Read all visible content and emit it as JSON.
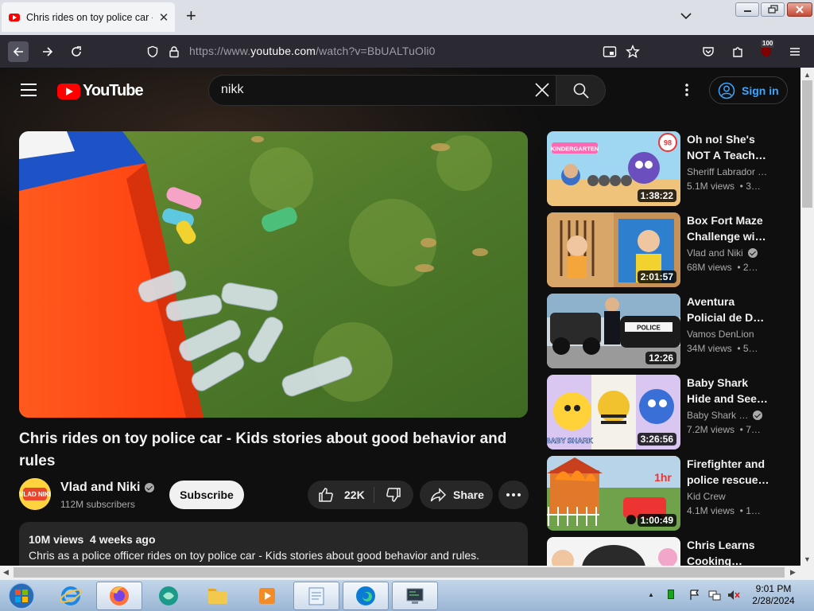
{
  "browser": {
    "tab_title": "Chris rides on toy police car - K",
    "url_prefix": "https://www.",
    "url_domain": "youtube.com",
    "url_path": "/watch?v=BbUALTuOli0",
    "extension_badge": "100"
  },
  "youtube": {
    "logo_text": "YouTube",
    "search_value": "nikk",
    "signin_label": "Sign in"
  },
  "video": {
    "title": "Chris rides on toy police car - Kids stories about good behavior and rules",
    "channel_name": "Vlad and Niki",
    "avatar_text": "VLAD NIKI",
    "subscribers": "112M subscribers",
    "subscribe_label": "Subscribe",
    "likes": "22K",
    "share_label": "Share",
    "meta": "10M views  4 weeks ago",
    "description": "Chris as a police officer rides on toy police car - Kids stories about good behavior and rules."
  },
  "recommendations": [
    {
      "title1": "Oh no! She's",
      "title2": "NOT A Teache…",
      "channel": "Sheriff Labrador …",
      "verified": false,
      "views": "5.1M views  • 3…",
      "duration": "1:38:22",
      "thumb_text": "KINDERGARTEN",
      "thumb_badge": "98"
    },
    {
      "title1": "Box Fort Maze",
      "title2": "Challenge wit…",
      "channel": "Vlad and Niki",
      "verified": true,
      "views": "68M views  • 2…",
      "duration": "2:01:57",
      "thumb_text": "",
      "thumb_badge": ""
    },
    {
      "title1": "Aventura",
      "title2": "Policial de De…",
      "channel": "Vamos DenLion",
      "verified": false,
      "views": "34M views  • 5…",
      "duration": "12:26",
      "thumb_text": "POLICE",
      "thumb_badge": ""
    },
    {
      "title1": "Baby Shark",
      "title2": "Hide and Seek…",
      "channel": "Baby Shark …",
      "verified": true,
      "views": "7.2M views  • 7…",
      "duration": "3:26:56",
      "thumb_text": "BABY SHARK",
      "thumb_badge": ""
    },
    {
      "title1": "Firefighter and",
      "title2": "police rescue…",
      "channel": "Kid Crew",
      "verified": false,
      "views": "4.1M views  • 1…",
      "duration": "1:00:49",
      "thumb_text": "1hr",
      "thumb_badge": ""
    },
    {
      "title1": "Chris Learns",
      "title2": "Cooking…",
      "channel": "",
      "verified": false,
      "views": "",
      "duration": "",
      "thumb_text": "",
      "thumb_badge": ""
    }
  ],
  "taskbar": {
    "time": "9:01 PM",
    "date": "2/28/2024"
  },
  "colors": {
    "yt_bg": "#0f0f0f",
    "yt_red": "#ff0000",
    "signin_blue": "#3ea6ff",
    "browser_toolbar": "#2b2a33"
  }
}
